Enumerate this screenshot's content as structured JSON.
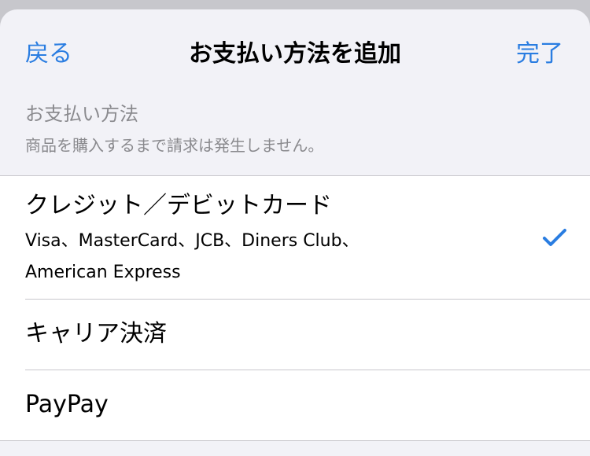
{
  "nav": {
    "back_label": "戻る",
    "title": "お支払い方法を追加",
    "done_label": "完了"
  },
  "section": {
    "header": "お支払い方法",
    "subtitle": "商品を購入するまで請求は発生しません。"
  },
  "payment_methods": [
    {
      "title": "クレジット／デビットカード",
      "description_line1": "Visa、MasterCard、JCB、Diners Club、",
      "description_line2": "American Express",
      "selected": true
    },
    {
      "title": "キャリア決済",
      "selected": false
    },
    {
      "title": "PayPay",
      "selected": false
    }
  ],
  "colors": {
    "accent": "#2a7de1",
    "background": "#f2f2f7",
    "secondary_text": "#8a8a8e"
  },
  "icons": {
    "selected_marker": "checkmark-icon"
  }
}
